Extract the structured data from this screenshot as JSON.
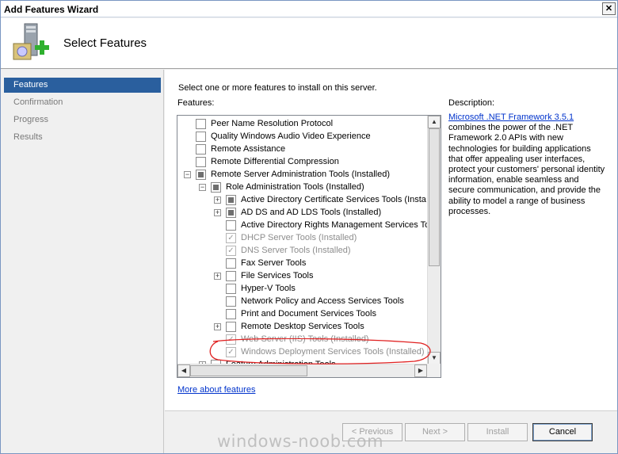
{
  "window": {
    "title": "Add Features Wizard",
    "close_glyph": "✕"
  },
  "header": {
    "heading": "Select Features",
    "icon": "server-add-icon"
  },
  "nav": {
    "items": [
      {
        "label": "Features",
        "active": true
      },
      {
        "label": "Confirmation",
        "active": false
      },
      {
        "label": "Progress",
        "active": false
      },
      {
        "label": "Results",
        "active": false
      }
    ]
  },
  "main": {
    "instruction": "Select one or more features to install on this server.",
    "features_label": "Features:",
    "more_link": "More about features"
  },
  "tree": [
    {
      "label": "Peer Name Resolution Protocol",
      "state": "unchecked",
      "expander": "",
      "level": 0
    },
    {
      "label": "Quality Windows Audio Video Experience",
      "state": "unchecked",
      "expander": "",
      "level": 0
    },
    {
      "label": "Remote Assistance",
      "state": "unchecked",
      "expander": "",
      "level": 0
    },
    {
      "label": "Remote Differential Compression",
      "state": "unchecked",
      "expander": "",
      "level": 0
    },
    {
      "label": "Remote Server Administration Tools  (Installed)",
      "state": "partial",
      "expander": "−",
      "level": 0
    },
    {
      "label": "Role Administration Tools  (Installed)",
      "state": "partial",
      "expander": "−",
      "level": 1
    },
    {
      "label": "Active Directory Certificate Services Tools  (Insta",
      "state": "partial",
      "expander": "+",
      "level": 2
    },
    {
      "label": "AD DS and AD LDS Tools  (Installed)",
      "state": "partial",
      "expander": "+",
      "level": 2
    },
    {
      "label": "Active Directory Rights Management Services Too",
      "state": "unchecked",
      "expander": "",
      "level": 2
    },
    {
      "label": "DHCP Server Tools  (Installed)",
      "state": "checked-disabled",
      "expander": "",
      "level": 2
    },
    {
      "label": "DNS Server Tools  (Installed)",
      "state": "checked-disabled",
      "expander": "",
      "level": 2
    },
    {
      "label": "Fax Server Tools",
      "state": "unchecked",
      "expander": "",
      "level": 2
    },
    {
      "label": "File Services Tools",
      "state": "unchecked",
      "expander": "+",
      "level": 2
    },
    {
      "label": "Hyper-V Tools",
      "state": "unchecked",
      "expander": "",
      "level": 2
    },
    {
      "label": "Network Policy and Access Services Tools",
      "state": "unchecked",
      "expander": "",
      "level": 2
    },
    {
      "label": "Print and Document Services Tools",
      "state": "unchecked",
      "expander": "",
      "level": 2
    },
    {
      "label": "Remote Desktop Services Tools",
      "state": "unchecked",
      "expander": "+",
      "level": 2
    },
    {
      "label": "Web Server (IIS) Tools  (Installed)",
      "state": "checked-disabled",
      "expander": "",
      "level": 2
    },
    {
      "label": "Windows Deployment Services Tools  (Installed)",
      "state": "checked-disabled",
      "expander": "",
      "level": 2
    },
    {
      "label": "Feature Administration Tools",
      "state": "unchecked",
      "expander": "+",
      "level": 1
    }
  ],
  "description": {
    "label": "Description:",
    "link": "Microsoft .NET Framework 3.5.1",
    "text": "combines the power of the .NET Framework 2.0 APIs with new technologies for building applications that offer appealing user interfaces, protect your customers' personal identity information, enable seamless and secure communication, and provide the ability to model a range of business processes."
  },
  "buttons": {
    "previous": "< Previous",
    "next": "Next >",
    "install": "Install",
    "cancel": "Cancel"
  },
  "watermark": "windows-noob.com",
  "colors": {
    "accent": "#2a5f9e",
    "link": "#0033cc",
    "annotation": "#e02020"
  }
}
